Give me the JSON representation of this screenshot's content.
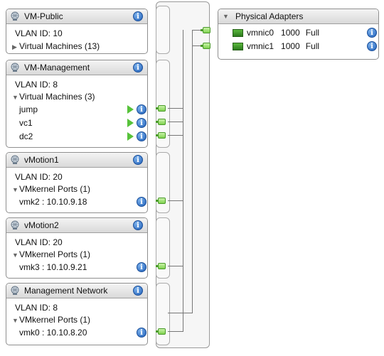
{
  "port_groups": [
    {
      "title": "VM-Public",
      "vlan": "VLAN ID: 10",
      "section": "Virtual Machines (13)",
      "expanded": false,
      "items": []
    },
    {
      "title": "VM-Management",
      "vlan": "VLAN ID: 8",
      "section": "Virtual Machines (3)",
      "expanded": true,
      "items": [
        "jump",
        "vc1",
        "dc2"
      ]
    },
    {
      "title": "vMotion1",
      "vlan": "VLAN ID: 20",
      "section": "VMkernel Ports (1)",
      "expanded": true,
      "items": [
        "vmk2 : 10.10.9.18"
      ]
    },
    {
      "title": "vMotion2",
      "vlan": "VLAN ID: 20",
      "section": "VMkernel Ports (1)",
      "expanded": true,
      "items": [
        "vmk3 : 10.10.9.21"
      ]
    },
    {
      "title": "Management Network",
      "vlan": "VLAN ID: 8",
      "section": "VMkernel Ports (1)",
      "expanded": true,
      "items": [
        "vmk0 : 10.10.8.20"
      ]
    }
  ],
  "physical_adapters": {
    "title": "Physical Adapters",
    "nics": [
      {
        "name": "vmnic0",
        "speed": "1000",
        "duplex": "Full"
      },
      {
        "name": "vmnic1",
        "speed": "1000",
        "duplex": "Full"
      }
    ]
  },
  "icons": {
    "port_group": "network-globe-icon",
    "info": "info-icon",
    "vm_power": "power-on-icon",
    "port": "port-connector-icon",
    "nic": "nic-card-icon"
  },
  "colors": {
    "info_blue": "#1f5fb8",
    "port_green": "#7fd24f",
    "power_green": "#57c23a"
  }
}
